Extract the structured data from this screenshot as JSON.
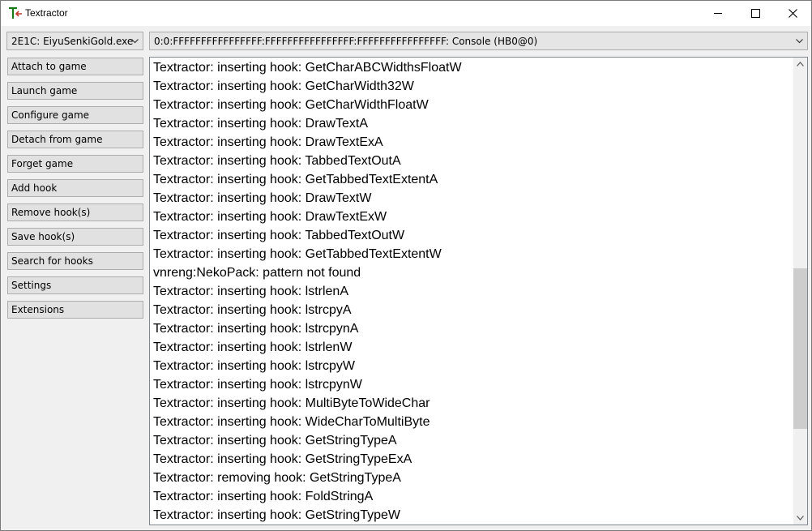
{
  "window": {
    "title": "Textractor"
  },
  "icons": {
    "app": "textractor-app-icon",
    "minimize": "minimize-icon",
    "maximize": "maximize-icon",
    "close": "close-icon",
    "dropdown": "chevron-down-icon"
  },
  "process_selector": {
    "value": "2E1C: EiyuSenkiGold.exe"
  },
  "thread_selector": {
    "value": "0:0:FFFFFFFFFFFFFFFF:FFFFFFFFFFFFFFFF:FFFFFFFFFFFFFFFF: Console (HB0@0)"
  },
  "buttons": [
    "Attach to game",
    "Launch game",
    "Configure game",
    "Detach from game",
    "Forget game",
    "Add hook",
    "Remove hook(s)",
    "Save hook(s)",
    "Search for hooks",
    "Settings",
    "Extensions"
  ],
  "console_lines": [
    "Textractor: inserting hook: GetCharABCWidthsFloatW",
    "Textractor: inserting hook: GetCharWidth32W",
    "Textractor: inserting hook: GetCharWidthFloatW",
    "Textractor: inserting hook: DrawTextA",
    "Textractor: inserting hook: DrawTextExA",
    "Textractor: inserting hook: TabbedTextOutA",
    "Textractor: inserting hook: GetTabbedTextExtentA",
    "Textractor: inserting hook: DrawTextW",
    "Textractor: inserting hook: DrawTextExW",
    "Textractor: inserting hook: TabbedTextOutW",
    "Textractor: inserting hook: GetTabbedTextExtentW",
    "vnreng:NekoPack: pattern not found",
    "Textractor: inserting hook: lstrlenA",
    "Textractor: inserting hook: lstrcpyA",
    "Textractor: inserting hook: lstrcpynA",
    "Textractor: inserting hook: lstrlenW",
    "Textractor: inserting hook: lstrcpyW",
    "Textractor: inserting hook: lstrcpynW",
    "Textractor: inserting hook: MultiByteToWideChar",
    "Textractor: inserting hook: WideCharToMultiByte",
    "Textractor: inserting hook: GetStringTypeA",
    "Textractor: inserting hook: GetStringTypeExA",
    "Textractor: removing hook: GetStringTypeA",
    "Textractor: inserting hook: FoldStringA",
    "Textractor: inserting hook: GetStringTypeW"
  ]
}
